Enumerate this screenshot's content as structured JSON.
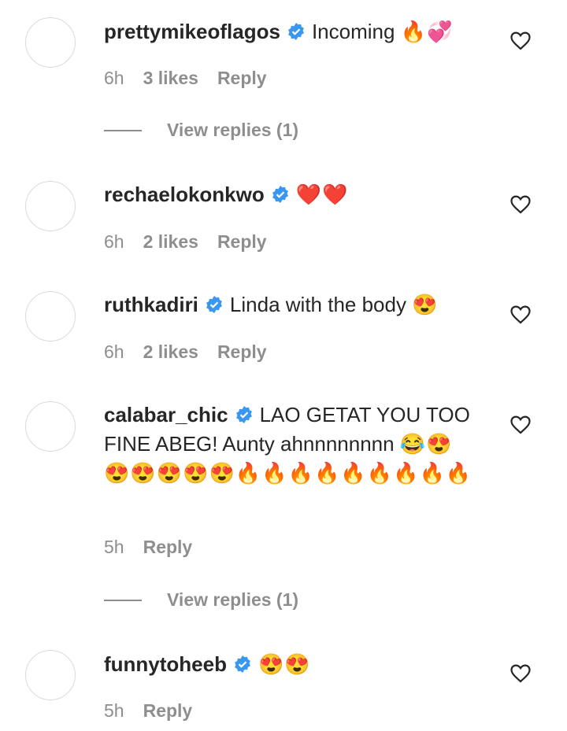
{
  "colors": {
    "text": "#262626",
    "muted": "#8e8e8e",
    "verified": "#3897f0"
  },
  "icons": {
    "verified": "verified-badge-icon",
    "like": "heart-outline-icon",
    "avatar": "avatar-placeholder"
  },
  "reply_label": "Reply",
  "comments": [
    {
      "username": "prettymikeoflagos",
      "text": "Incoming",
      "emojis": "🔥💞",
      "time": "6h",
      "likes": "3 likes",
      "view_replies": "View replies (1)"
    },
    {
      "username": "rechaelokonkwo",
      "text": "",
      "emojis": "❤️❤️",
      "time": "6h",
      "likes": "2 likes"
    },
    {
      "username": "ruthkadiri",
      "text": "Linda with the body",
      "emojis": "😍",
      "time": "6h",
      "likes": "2 likes"
    },
    {
      "username": "calabar_chic",
      "text": "LAO GETAT YOU TOO FINE ABEG! Aunty ahnnnnnnnn",
      "emojis": "😂😍😍😍😍😍😍🔥🔥🔥🔥🔥🔥🔥🔥🔥",
      "time": "5h",
      "view_replies": "View replies (1)"
    },
    {
      "username": "funnytoheeb",
      "text": "",
      "emojis": "😍😍",
      "time": "5h"
    }
  ]
}
